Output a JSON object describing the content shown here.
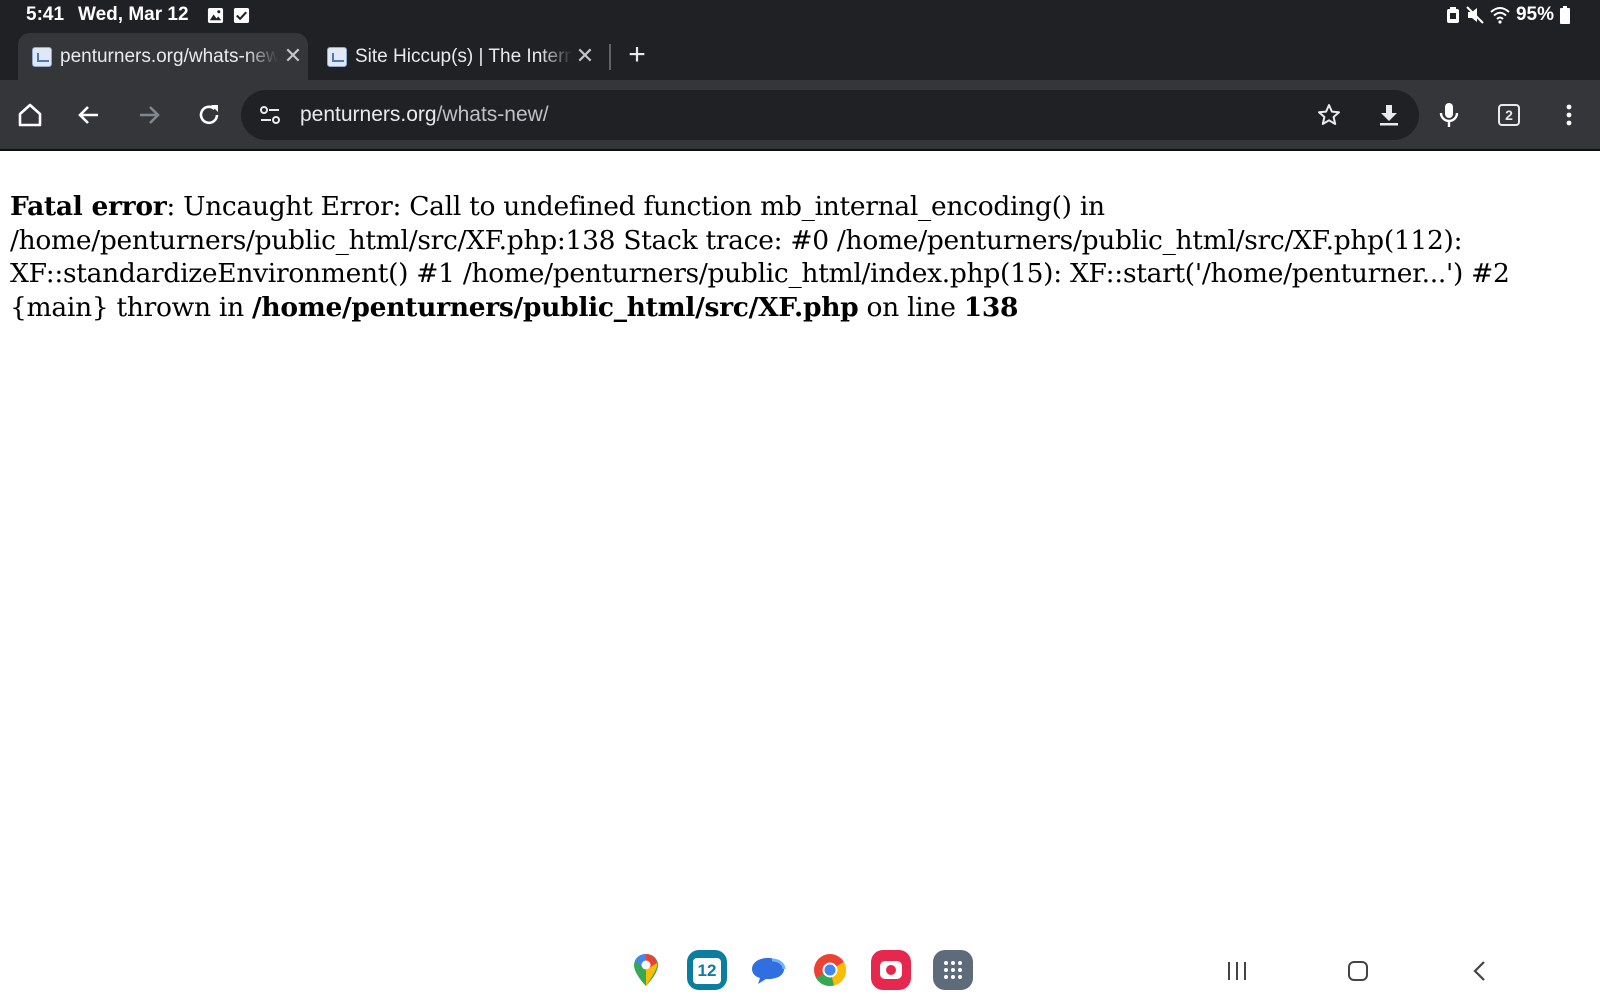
{
  "status_bar": {
    "time": "5:41",
    "date": "Wed, Mar 12",
    "battery": "95%"
  },
  "tabs": [
    {
      "title": "penturners.org/whats-new/",
      "active": true
    },
    {
      "title": "Site Hiccup(s) | The Internationa",
      "active": false
    }
  ],
  "toolbar": {
    "url_domain": "penturners.org",
    "url_path": "/whats-new/",
    "tab_count": "2"
  },
  "error": {
    "label": "Fatal error",
    "message": ": Uncaught Error: Call to undefined function mb_internal_encoding() in /home/penturners/public_html/src/XF.php:138 Stack trace: #0 /home/penturners/public_html/src/XF.php(112): XF::standardizeEnvironment() #1 /home/penturners/public_html/index.php(15): XF::start('/home/penturner...') #2 {main} thrown in ",
    "file": "/home/penturners/public_html/src/XF.php",
    "line_text": " on line ",
    "line_number": "138"
  },
  "colors": {
    "chrome_dark": "#202124",
    "toolbar": "#35363a",
    "calendar_teal": "#0b7d9e",
    "camera_red": "#e6274e",
    "apps_grid": "#5d6b7a"
  },
  "dock_apps": [
    "maps-icon",
    "calendar-icon",
    "messages-icon",
    "chrome-icon",
    "camera-icon",
    "apps-grid-icon"
  ],
  "calendar_day": "12"
}
